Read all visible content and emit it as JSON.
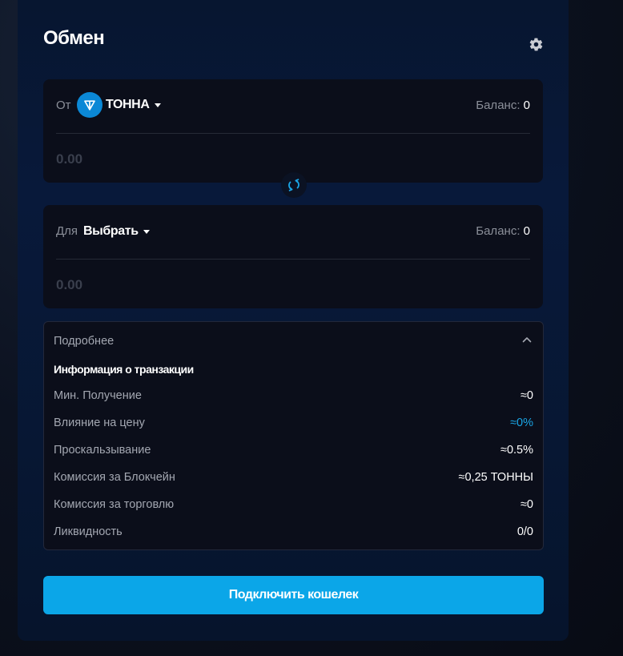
{
  "header": {
    "title": "Обмен",
    "settings_icon": "gear-icon"
  },
  "from": {
    "label": "От",
    "token": "ТОННА",
    "token_icon": "ton-icon",
    "balance_label": "Баланс:",
    "balance_value": "0",
    "amount_placeholder": "0.00"
  },
  "swap": {
    "icon": "swap-arrows-icon"
  },
  "to": {
    "label": "Для",
    "token": "Выбрать",
    "balance_label": "Баланс:",
    "balance_value": "0",
    "amount_placeholder": "0.00"
  },
  "details": {
    "title": "Подробнее",
    "subtitle": "Информация о транзакции",
    "rows": [
      {
        "key": "Мин. Получение",
        "value": "≈0"
      },
      {
        "key": "Влияние на цену",
        "value": "≈0%"
      },
      {
        "key": "Проскальзывание",
        "value": "≈0.5%"
      },
      {
        "key": "Комиссия за Блокчейн",
        "value": "≈0,25 ТОННЫ"
      },
      {
        "key": "Комиссия за торговлю",
        "value": "≈0"
      },
      {
        "key": "Ликвидность",
        "value": "0/0"
      }
    ]
  },
  "connect_button": "Подключить кошелек",
  "colors": {
    "accent": "#0ba6e8",
    "card": "#07173a",
    "panel": "#0b0e1a",
    "muted_text": "#a3a7b1"
  }
}
